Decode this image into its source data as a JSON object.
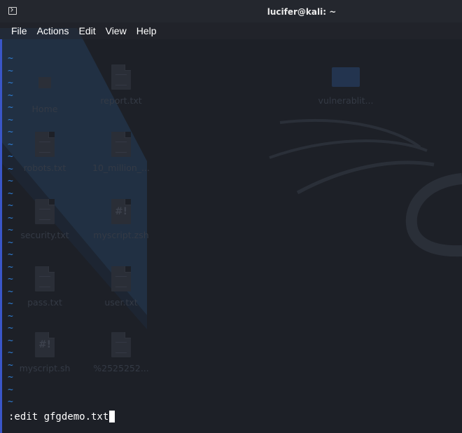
{
  "window": {
    "title": "lucifer@kali: ~"
  },
  "menu": [
    "File",
    "Actions",
    "Edit",
    "View",
    "Help"
  ],
  "editor": {
    "tilde_char": "~",
    "empty_line_count": 29,
    "command": ":edit gfgdemo.txt"
  },
  "desktop_icons": [
    {
      "label": "Home",
      "kind": "home"
    },
    {
      "label": "report.txt",
      "kind": "text"
    },
    {
      "label": "vulnerablit...",
      "kind": "folder"
    },
    {
      "label": "robots.txt",
      "kind": "text"
    },
    {
      "label": "10_million_...",
      "kind": "text"
    },
    {
      "label": "security.txt",
      "kind": "text"
    },
    {
      "label": "myscript.zsh",
      "kind": "script"
    },
    {
      "label": "pass.txt",
      "kind": "text"
    },
    {
      "label": "user.txt",
      "kind": "text"
    },
    {
      "label": "myscript.sh",
      "kind": "script"
    },
    {
      "label": "%2525252...",
      "kind": "text"
    }
  ],
  "colors": {
    "background": "#1d2027",
    "titlebar": "#24272e",
    "tilde": "#2f7fd6",
    "text": "#ffffff",
    "accent_edge": "#3a56c8"
  }
}
